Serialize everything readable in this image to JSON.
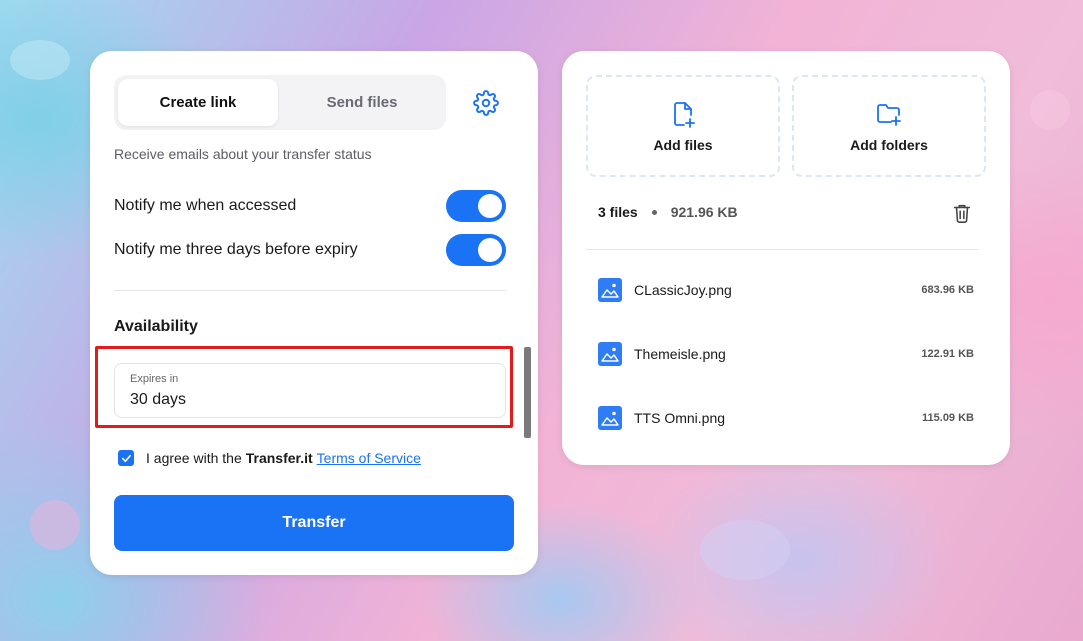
{
  "tabs": {
    "create_link": "Create link",
    "send_files": "Send files"
  },
  "settings": {
    "note": "Receive emails about your transfer status"
  },
  "toggles": [
    {
      "label": "Notify me when accessed",
      "on": true
    },
    {
      "label": "Notify me three days before expiry",
      "on": true
    }
  ],
  "availability": {
    "title": "Availability",
    "expires_label": "Expires in",
    "expires_value": "30 days"
  },
  "agreement": {
    "prefix": "I agree with the",
    "brand": "Transfer.it",
    "link": "Terms of Service",
    "checked": true
  },
  "transfer_button": "Transfer",
  "upload": {
    "add_files": "Add files",
    "add_folders": "Add folders"
  },
  "summary": {
    "count": "3 files",
    "total": "921.96 KB"
  },
  "files": [
    {
      "name": "CLassicJoy.png",
      "size": "683.96 KB"
    },
    {
      "name": "Themeisle.png",
      "size": "122.91 KB"
    },
    {
      "name": "TTS Omni.png",
      "size": "115.09 KB"
    }
  ],
  "colors": {
    "accent": "#1a73f5",
    "highlight": "#e01b1b"
  },
  "icons": [
    "gear-icon",
    "check-icon",
    "add-file-icon",
    "add-folder-icon",
    "trash-icon",
    "image-file-icon"
  ]
}
